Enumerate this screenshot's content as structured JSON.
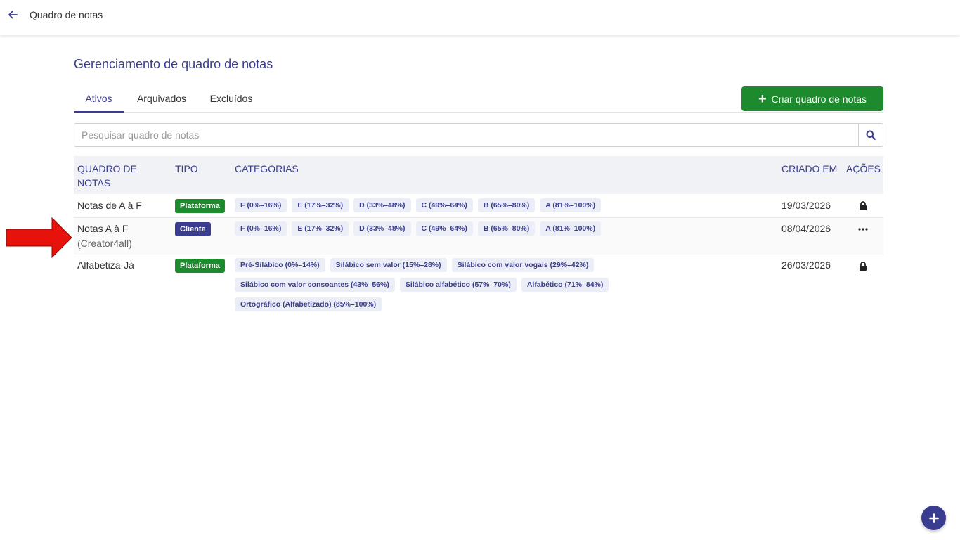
{
  "topbar": {
    "title": "Quadro de notas",
    "back_icon": "arrow-left-icon"
  },
  "page": {
    "title": "Gerenciamento de quadro de notas"
  },
  "tabs": [
    {
      "label": "Ativos",
      "active": true
    },
    {
      "label": "Arquivados",
      "active": false
    },
    {
      "label": "Excluídos",
      "active": false
    }
  ],
  "create_button": {
    "label": "Criar quadro de notas"
  },
  "search": {
    "placeholder": "Pesquisar quadro de notas",
    "value": ""
  },
  "table": {
    "headers": {
      "name_line1": "QUADRO DE",
      "name_line2": "NOTAS",
      "type": "TIPO",
      "categories": "CATEGORIAS",
      "created": "CRIADO EM",
      "actions": "AÇÕES"
    },
    "rows": [
      {
        "name": "Notas de A à F",
        "sub": "",
        "type": "Plataforma",
        "categories": [
          "F (0%–16%)",
          "E (17%–32%)",
          "D (33%–48%)",
          "C (49%–64%)",
          "B (65%–80%)",
          "A (81%–100%)"
        ],
        "created": "19/03/2026",
        "action_icon": "lock-icon"
      },
      {
        "name": "Notas A à F",
        "sub": "(Creator4all)",
        "type": "Cliente",
        "categories": [
          "F (0%–16%)",
          "E (17%–32%)",
          "D (33%–48%)",
          "C (49%–64%)",
          "B (65%–80%)",
          "A (81%–100%)"
        ],
        "created": "08/04/2026",
        "action_icon": "more-icon"
      },
      {
        "name": "Alfabetiza-Já",
        "sub": "",
        "type": "Plataforma",
        "categories": [
          "Pré-Silábico (0%–14%)",
          "Silábico sem valor (15%–28%)",
          "Silábico com valor vogais (29%–42%)",
          "Silábico com valor consoantes (43%–56%)",
          "Silábico alfabético (57%–70%)",
          "Alfabético (71%–84%)",
          "Ortográfico (Alfabetizado) (85%–100%)"
        ],
        "created": "26/03/2026",
        "action_icon": "lock-icon"
      }
    ]
  },
  "colors": {
    "primary": "#3a3d8f",
    "success": "#1e8a2e",
    "chip_bg": "#eceef7",
    "annotation_arrow": "#e8120c"
  }
}
